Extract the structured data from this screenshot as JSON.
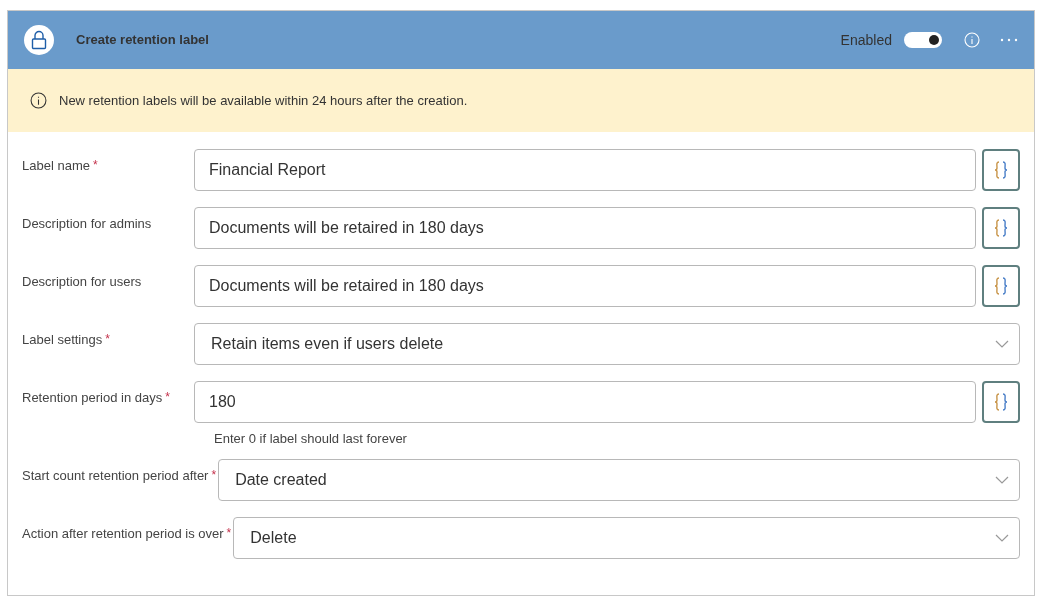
{
  "header": {
    "title": "Create retention label",
    "toggle_label": "Enabled",
    "enabled": true
  },
  "banner": {
    "text": "New retention labels will be available within 24 hours after the creation."
  },
  "fields": [
    {
      "kind": "text",
      "label": "Label name",
      "required_mark": "*",
      "value": "Financial Report"
    },
    {
      "kind": "text",
      "label": "Description for admins",
      "value": "Documents will be retaired in 180 days"
    },
    {
      "kind": "text",
      "label": "Description for users",
      "value": "Documents will be retaired in 180 days"
    },
    {
      "kind": "dropdown",
      "label": "Label settings",
      "required_mark": "*",
      "value": "Retain items even if users delete"
    },
    {
      "kind": "text",
      "label": "Retention period in days",
      "required_mark": "*",
      "value": "180",
      "hint": "Enter 0 if label should last forever"
    },
    {
      "kind": "dropdown",
      "label": "Start count retention period after",
      "required_mark": "*",
      "value": "Date created"
    },
    {
      "kind": "dropdown",
      "label": "Action after retention period is over",
      "required_mark": "*",
      "value": "Delete"
    }
  ]
}
